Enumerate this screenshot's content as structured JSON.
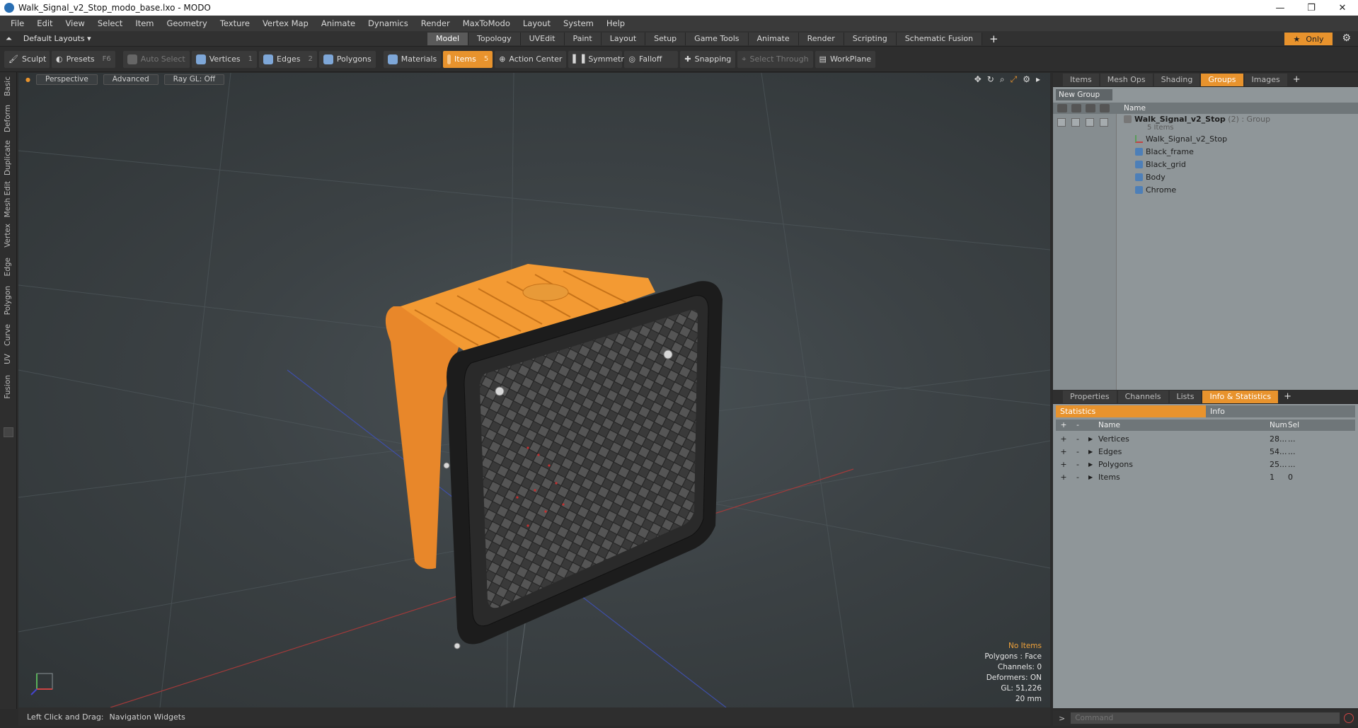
{
  "window": {
    "title": "Walk_Signal_v2_Stop_modo_base.lxo - MODO",
    "minimize": "—",
    "maximize": "❐",
    "close": "✕"
  },
  "menu": [
    "File",
    "Edit",
    "View",
    "Select",
    "Item",
    "Geometry",
    "Texture",
    "Vertex Map",
    "Animate",
    "Dynamics",
    "Render",
    "MaxToModo",
    "Layout",
    "System",
    "Help"
  ],
  "layoutbar": {
    "layout_selector": "Default Layouts ▾",
    "tabs": [
      "Model",
      "Topology",
      "UVEdit",
      "Paint",
      "Layout",
      "Setup",
      "Game Tools",
      "Animate",
      "Render",
      "Scripting",
      "Schematic Fusion"
    ],
    "active_tab": "Model",
    "only_label": "Only",
    "plus": "+"
  },
  "toolbar": {
    "sculpt": "Sculpt",
    "presets": "Presets",
    "presets_key": "F6",
    "auto_select": "Auto Select",
    "vertices": "Vertices",
    "vertices_count": "1",
    "edges": "Edges",
    "edges_count": "2",
    "polygons": "Polygons",
    "materials": "Materials",
    "items": "Items",
    "items_count": "5",
    "action_center": "Action Center",
    "symmetry": "Symmetry",
    "falloff": "Falloff",
    "snapping": "Snapping",
    "select_through": "Select Through",
    "workplane": "WorkPlane"
  },
  "leftstrip": [
    "Basic",
    "Deform",
    "Duplicate",
    "Mesh Edit",
    "Vertex",
    "Edge",
    "Polygon",
    "Curve",
    "UV",
    "Fusion"
  ],
  "viewport": {
    "view_mode": "Perspective",
    "shading": "Advanced",
    "raygl": "Ray GL: Off",
    "info": {
      "selection": "No Items",
      "polygons": "Polygons : Face",
      "channels": "Channels: 0",
      "deformers": "Deformers: ON",
      "gl": "GL: 51,226",
      "scale": "20 mm"
    }
  },
  "statusbar": {
    "hint": "Left Click and Drag:",
    "action": "Navigation Widgets"
  },
  "groups_panel": {
    "tabs": [
      "Items",
      "Mesh Ops",
      "Shading",
      "Groups",
      "Images"
    ],
    "active_tab": "Groups",
    "new_group": "New Group",
    "col_name": "Name",
    "group_name": "Walk_Signal_v2_Stop",
    "group_suffix": "(2) : Group",
    "group_count": "5 Items",
    "children": [
      "Walk_Signal_v2_Stop",
      "Black_frame",
      "Black_grid",
      "Body",
      "Chrome"
    ]
  },
  "stats_panel": {
    "tabs": [
      "Properties",
      "Channels",
      "Lists",
      "Info & Statistics"
    ],
    "active_tab": "Info & Statistics",
    "sub_tabs": [
      "Statistics",
      "Info"
    ],
    "col_name": "Name",
    "col_num": "Num",
    "col_sel": "Sel",
    "rows": [
      {
        "name": "Vertices",
        "num": "28...",
        "sel": "..."
      },
      {
        "name": "Edges",
        "num": "54...",
        "sel": "..."
      },
      {
        "name": "Polygons",
        "num": "25...",
        "sel": "..."
      },
      {
        "name": "Items",
        "num": "1",
        "sel": "0"
      }
    ]
  },
  "command": {
    "prompt": ">",
    "placeholder": "Command"
  },
  "colors": {
    "accent": "#e8932d",
    "body_orange": "#f0962a",
    "frame_black": "#1c1c1c"
  }
}
